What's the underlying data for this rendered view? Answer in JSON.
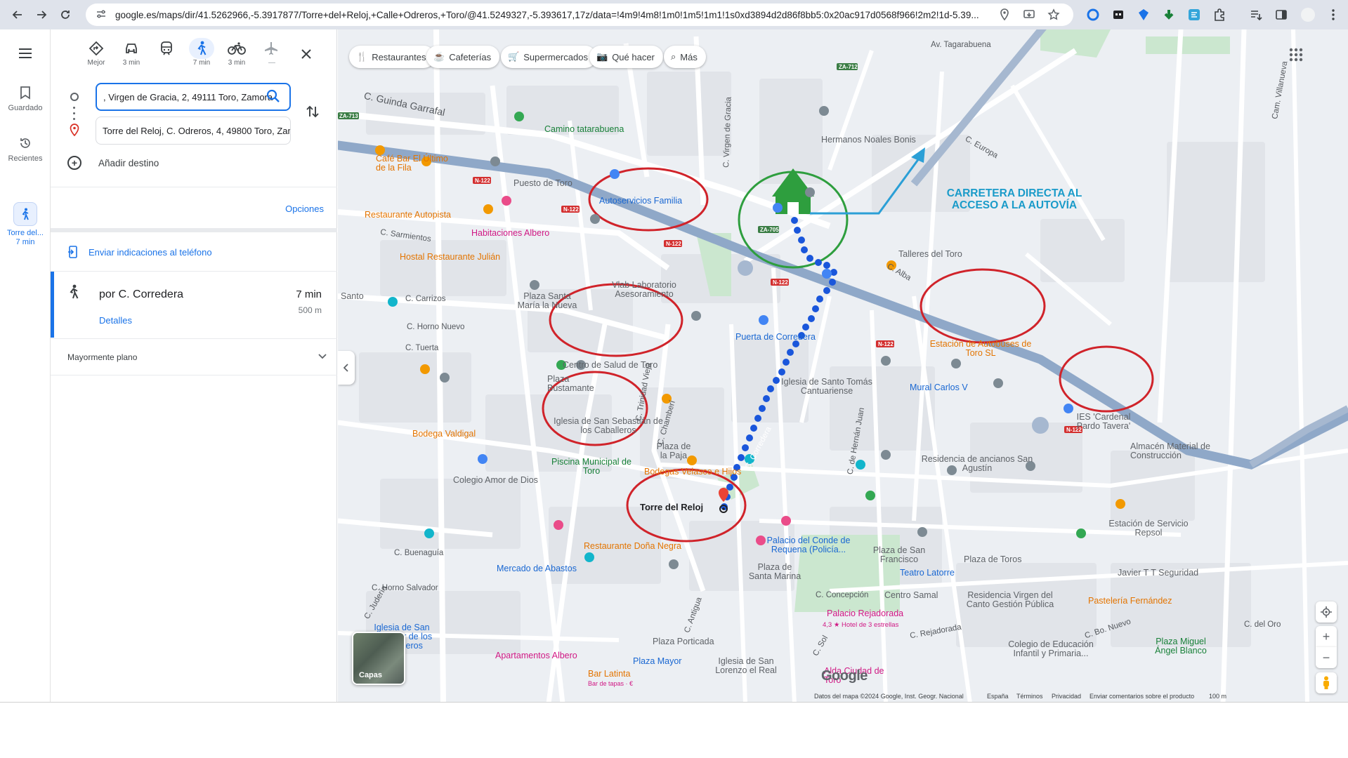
{
  "browser": {
    "url": "google.es/maps/dir/41.5262966,-5.3917877/Torre+del+Reloj,+Calle+Odreros,+Toro/@41.5249327,-5.393617,17z/data=!4m9!4m8!1m0!1m5!1m1!1s0xd3894d2d86f8bb5:0x20ac917d0568f966!2m2!1d-5.39...",
    "back_icon": "arrow-left",
    "forward_icon": "arrow-right",
    "reload_icon": "reload"
  },
  "rail": {
    "menu_icon": "hamburger",
    "saved": "Guardado",
    "recents": "Recientes",
    "active_trip": "Torre del...",
    "active_trip_time": "7 min"
  },
  "modes": [
    {
      "name": "best",
      "label": "Mejor"
    },
    {
      "name": "car",
      "label": "3 min"
    },
    {
      "name": "transit",
      "label": ""
    },
    {
      "name": "walk",
      "label": "7 min"
    },
    {
      "name": "bike",
      "label": "3 min"
    },
    {
      "name": "flight",
      "label": "—"
    }
  ],
  "directions": {
    "origin_value": ", Virgen de Gracia, 2, 49111 Toro, Zamora",
    "destination_value": "Torre del Reloj, C. Odreros, 4, 49800 Toro, Zamora",
    "add_destination": "Añadir destino",
    "options": "Opciones",
    "send_to_phone": "Enviar indicaciones al teléfono",
    "route_name": "por C. Corredera",
    "route_time": "7 min",
    "route_distance": "500 m",
    "details": "Detalles",
    "terrain_note": "Mayormente plano"
  },
  "map": {
    "chips": [
      {
        "icon": "restaurant-icon",
        "glyph": "🍴",
        "label": "Restaurantes"
      },
      {
        "icon": "cafe-icon",
        "glyph": "☕",
        "label": "Cafeterías"
      },
      {
        "icon": "cart-icon",
        "glyph": "🛒",
        "label": "Supermercados"
      },
      {
        "icon": "camera-icon",
        "glyph": "📷",
        "label": "Qué hacer"
      },
      {
        "icon": "search-icon",
        "glyph": "⌕",
        "label": "Más"
      }
    ],
    "layers_label": "Capas",
    "annotation": "CARRETERA DIRECTA AL ACCESO A LA AUTOVÍA",
    "destination_label": "Torre del Reloj",
    "attribution": {
      "data": "Datos del mapa ©2024 Google, Inst. Geogr. Nacional",
      "country": "España",
      "terms": "Términos",
      "privacy": "Privacidad",
      "feedback": "Enviar comentarios sobre el producto",
      "scale": "100 m"
    },
    "google_logo": "Google",
    "labels": {
      "av_tagarabuena": "Av. Tagarabuena",
      "za712": "ZA-712",
      "guinda": "C. Guinda Garrafal",
      "camino": "Camino tatarabuena",
      "hermanos": "Hermanos Noales Bonis",
      "europa": "C. Europa",
      "villanueva": "Cam. Villanueva",
      "cafe_bar": "Café Bar El Último de la Fila",
      "puesto_toro": "Puesto de Toro",
      "autoservicios": "Autoservicios Familia",
      "restaurante_autopista": "Restaurante Autopista",
      "sarmientos": "C. Sarmientos",
      "habitaciones": "Habitaciones Albero",
      "hostal": "Hostal Restaurante Julián",
      "vlab": "Vlab Laboratorio Asesoramiento",
      "talleres": "Talleres del Toro",
      "alba": "C. Alba",
      "za705": "ZA-705",
      "santo": "Santo",
      "carrizos": "C. Carrizos",
      "plaza_santa": "Plaza Santa María la Nueva",
      "horno_nuevo": "C. Horno Nuevo",
      "tuerta": "C. Tuerta",
      "puerta_corredera": "Puerta de Corredera",
      "estacion_autobuses": "Estación de Autobuses de Toro SL",
      "centro_salud": "Centro de Salud de Toro",
      "bustamante": "Plaza Bustamante",
      "iglesia_santo": "Iglesia de Santo Tomás Cantuariense",
      "mural": "Mural Carlos V",
      "iglesia_sebastian": "Iglesia de San Sebastián de los Caballeros",
      "bodega_valdigal": "Bodega Valdigal",
      "colegio_amor": "Colegio Amor de Dios",
      "piscina": "Piscina Municipal de Toro",
      "plaza_paja": "Plaza de la Paja",
      "bodegas_velasco": "Bodegas Velasco e Hijos",
      "ies": "IES 'Cardenal Pardo Tavera'",
      "residencia": "Residencia de ancianos San Agustín",
      "almacen": "Almacén Material de Construcción",
      "repsol": "Estación de Servicio Repsol",
      "restaurante_dona": "Restaurante Doña Negra",
      "mercado": "Mercado de Abastos",
      "buenaguia": "C. Buenaguía",
      "horno_salvador": "C. Horno Salvador",
      "plaza_santa_marina": "Plaza de Santa Marina",
      "palacio_conde": "Palacio del Conde de Requena (Policía...",
      "plaza_san_francisco": "Plaza de San Francisco",
      "plaza_toros": "Plaza de Toros",
      "teatro": "Teatro Latorre",
      "javier": "Javier T T Seguridad",
      "concepcion": "C. Concepción",
      "centro_samal": "Centro Samal",
      "residencia_virgen": "Residencia Virgen del Canto Gestión Pública",
      "pasteleria": "Pastelería Fernández",
      "iglesia_salvador": "Iglesia de San Salvador de los Caballeros",
      "apartamentos": "Apartamentos Albero",
      "palacio_rejadorada": "Palacio Rejadorada",
      "hotel": "4,3 ★ Hotel de 3 estrellas",
      "plaza_porticada": "Plaza Porticada",
      "plaza_mayor": "Plaza Mayor",
      "iglesia_lorenzo": "Iglesia de San Lorenzo el Real",
      "bar_latina": "Bar Latinta",
      "bar_tapas": "Bar de tapas · €",
      "alda": "Alda Ciudad de Toro",
      "colegio_educacion": "Colegio de Educación Infantil y Primaria...",
      "plaza_miguel": "Plaza Miguel Ángel Blanco",
      "rejadorada": "C. Rejadorada",
      "bo_nuevo": "C. Bo. Nuevo",
      "del_oro": "C. del Oro",
      "n122": "N-122",
      "virgen_gracia": "C. Virgen de Gracia",
      "mas_label": "Más",
      "corredera": "C. Corredera",
      "trinidad": "C. Trinidad Vieja",
      "chamberi": "C. Chamberí",
      "antigua": "C. Antigua",
      "hernan": "C. de Hernán Juan",
      "judería": "C. Judería",
      "saldo": "C. Sol"
    }
  }
}
